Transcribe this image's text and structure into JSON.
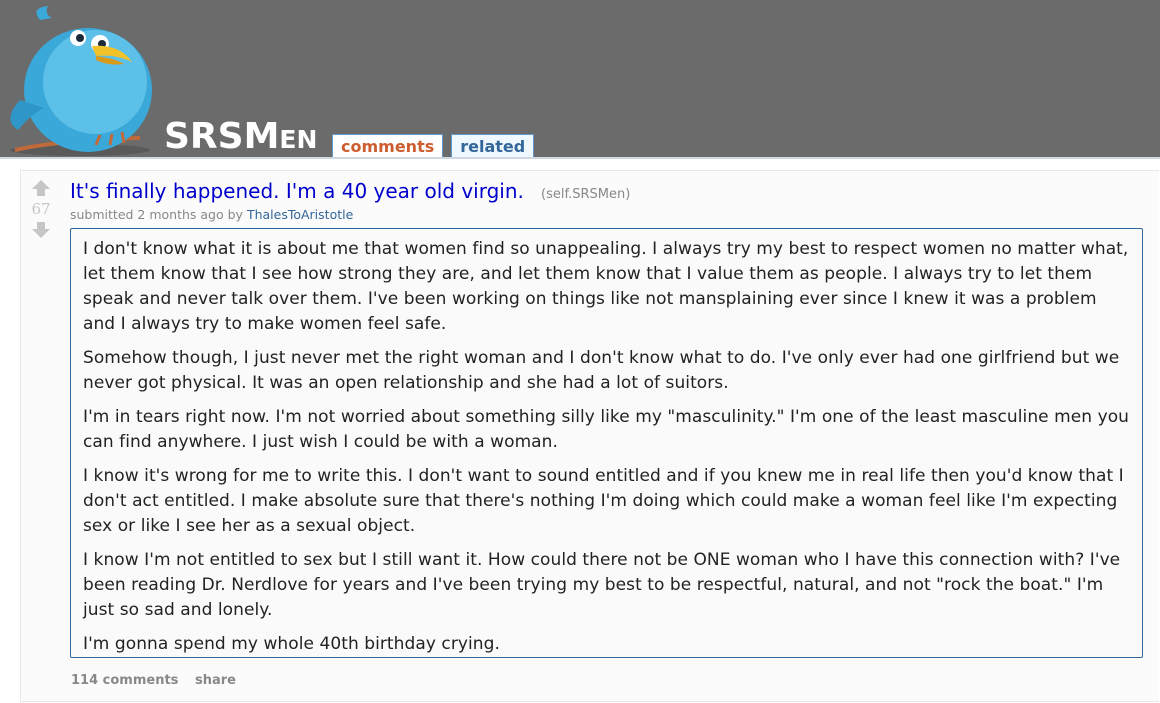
{
  "header": {
    "subreddit_name": "SRSMen",
    "tabs": [
      {
        "label": "comments",
        "selected": true
      },
      {
        "label": "related",
        "selected": false
      }
    ],
    "mascot_icon": "blue-bird-mascot-icon",
    "colors": {
      "header_bg": "#6b6b6b",
      "tab_selected": "#cd5d2f",
      "tab_link": "#336699"
    }
  },
  "post": {
    "score": "67",
    "title": "It's finally happened. I'm a 40 year old virgin.",
    "domain": "(self.SRSMen)",
    "tagline_prefix": "submitted 2 months ago by",
    "author": "ThalesToAristotle",
    "selftext": [
      "I don't know what it is about me that women find so unappealing. I always try my best to respect women no matter what, let them know that I see how strong they are, and let them know that I value them as people. I always try to let them speak and never talk over them. I've been working on things like not mansplaining ever since I knew it was a problem and I always try to make women feel safe.",
      "Somehow though, I just never met the right woman and I don't know what to do. I've only ever had one girlfriend but we never got physical. It was an open relationship and she had a lot of suitors.",
      "I'm in tears right now. I'm not worried about something silly like my \"masculinity.\" I'm one of the least masculine men you can find anywhere. I just wish I could be with a woman.",
      "I know it's wrong for me to write this. I don't want to sound entitled and if you knew me in real life then you'd know that I don't act entitled. I make absolute sure that there's nothing I'm doing which could make a woman feel like I'm expecting sex or like I see her as a sexual object.",
      "I know I'm not entitled to sex but I still want it. How could there not be ONE woman who I have this connection with? I've been reading Dr. Nerdlove for years and I've been trying my best to be respectful, natural, and not \"rock the boat.\" I'm just so sad and lonely.",
      "I'm gonna spend my whole 40th birthday crying."
    ],
    "buttons": {
      "comments": "114 comments",
      "share": "share"
    },
    "icons": {
      "upvote": "upvote-arrow-icon",
      "downvote": "downvote-arrow-icon"
    }
  }
}
